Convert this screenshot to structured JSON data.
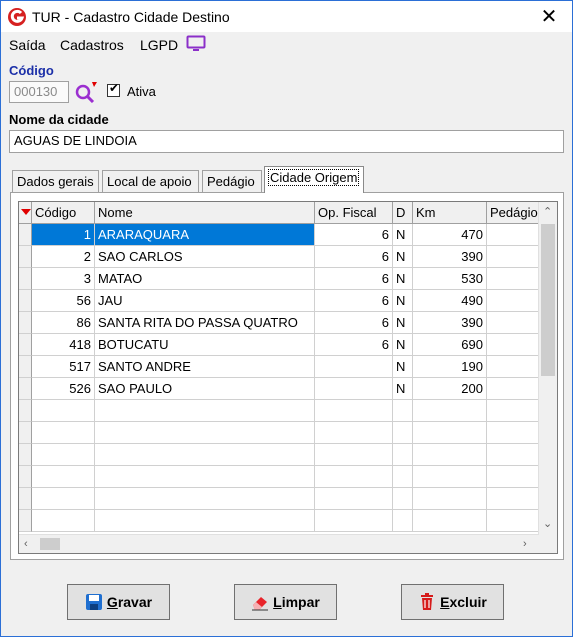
{
  "window": {
    "title": "TUR - Cadastro Cidade Destino",
    "close_glyph": "✕"
  },
  "menu": {
    "items": [
      "Saída",
      "Cadastros",
      "LGPD"
    ],
    "icon": "monitor-icon"
  },
  "form": {
    "codigo_label": "Código",
    "codigo_value": "000130",
    "ativa_label": "Ativa",
    "ativa_checked": true,
    "nome_label": "Nome da cidade",
    "nome_value": "AGUAS DE LINDOIA"
  },
  "tabs": [
    {
      "label": "Dados gerais",
      "active": false
    },
    {
      "label": "Local de apoio",
      "active": false
    },
    {
      "label": "Pedágio",
      "active": false
    },
    {
      "label": "Cidade Origem",
      "active": true
    }
  ],
  "grid": {
    "columns": [
      "Código",
      "Nome",
      "Op. Fiscal",
      "D",
      "Km",
      "Pedágio"
    ],
    "rows": [
      {
        "codigo": "1",
        "nome": "ARARAQUARA",
        "op_fiscal": "6",
        "d": "N",
        "km": "470",
        "pedagio": ""
      },
      {
        "codigo": "2",
        "nome": "SAO CARLOS",
        "op_fiscal": "6",
        "d": "N",
        "km": "390",
        "pedagio": ""
      },
      {
        "codigo": "3",
        "nome": "MATAO",
        "op_fiscal": "6",
        "d": "N",
        "km": "530",
        "pedagio": ""
      },
      {
        "codigo": "56",
        "nome": "JAU",
        "op_fiscal": "6",
        "d": "N",
        "km": "490",
        "pedagio": ""
      },
      {
        "codigo": "86",
        "nome": "SANTA RITA DO PASSA QUATRO",
        "op_fiscal": "6",
        "d": "N",
        "km": "390",
        "pedagio": ""
      },
      {
        "codigo": "418",
        "nome": "BOTUCATU",
        "op_fiscal": "6",
        "d": "N",
        "km": "690",
        "pedagio": ""
      },
      {
        "codigo": "517",
        "nome": "SANTO ANDRE",
        "op_fiscal": "",
        "d": "N",
        "km": "190",
        "pedagio": ""
      },
      {
        "codigo": "526",
        "nome": "SAO PAULO",
        "op_fiscal": "",
        "d": "N",
        "km": "200",
        "pedagio": ""
      }
    ],
    "selected_row": 0
  },
  "buttons": {
    "gravar": {
      "hotkey": "G",
      "rest": "ravar"
    },
    "limpar": {
      "hotkey": "L",
      "rest": "impar"
    },
    "excluir": {
      "hotkey": "E",
      "rest": "xcluir"
    }
  },
  "colors": {
    "selection": "#0078d7",
    "accent_purple": "#8b2fc9",
    "sort_indicator": "#e00000"
  }
}
